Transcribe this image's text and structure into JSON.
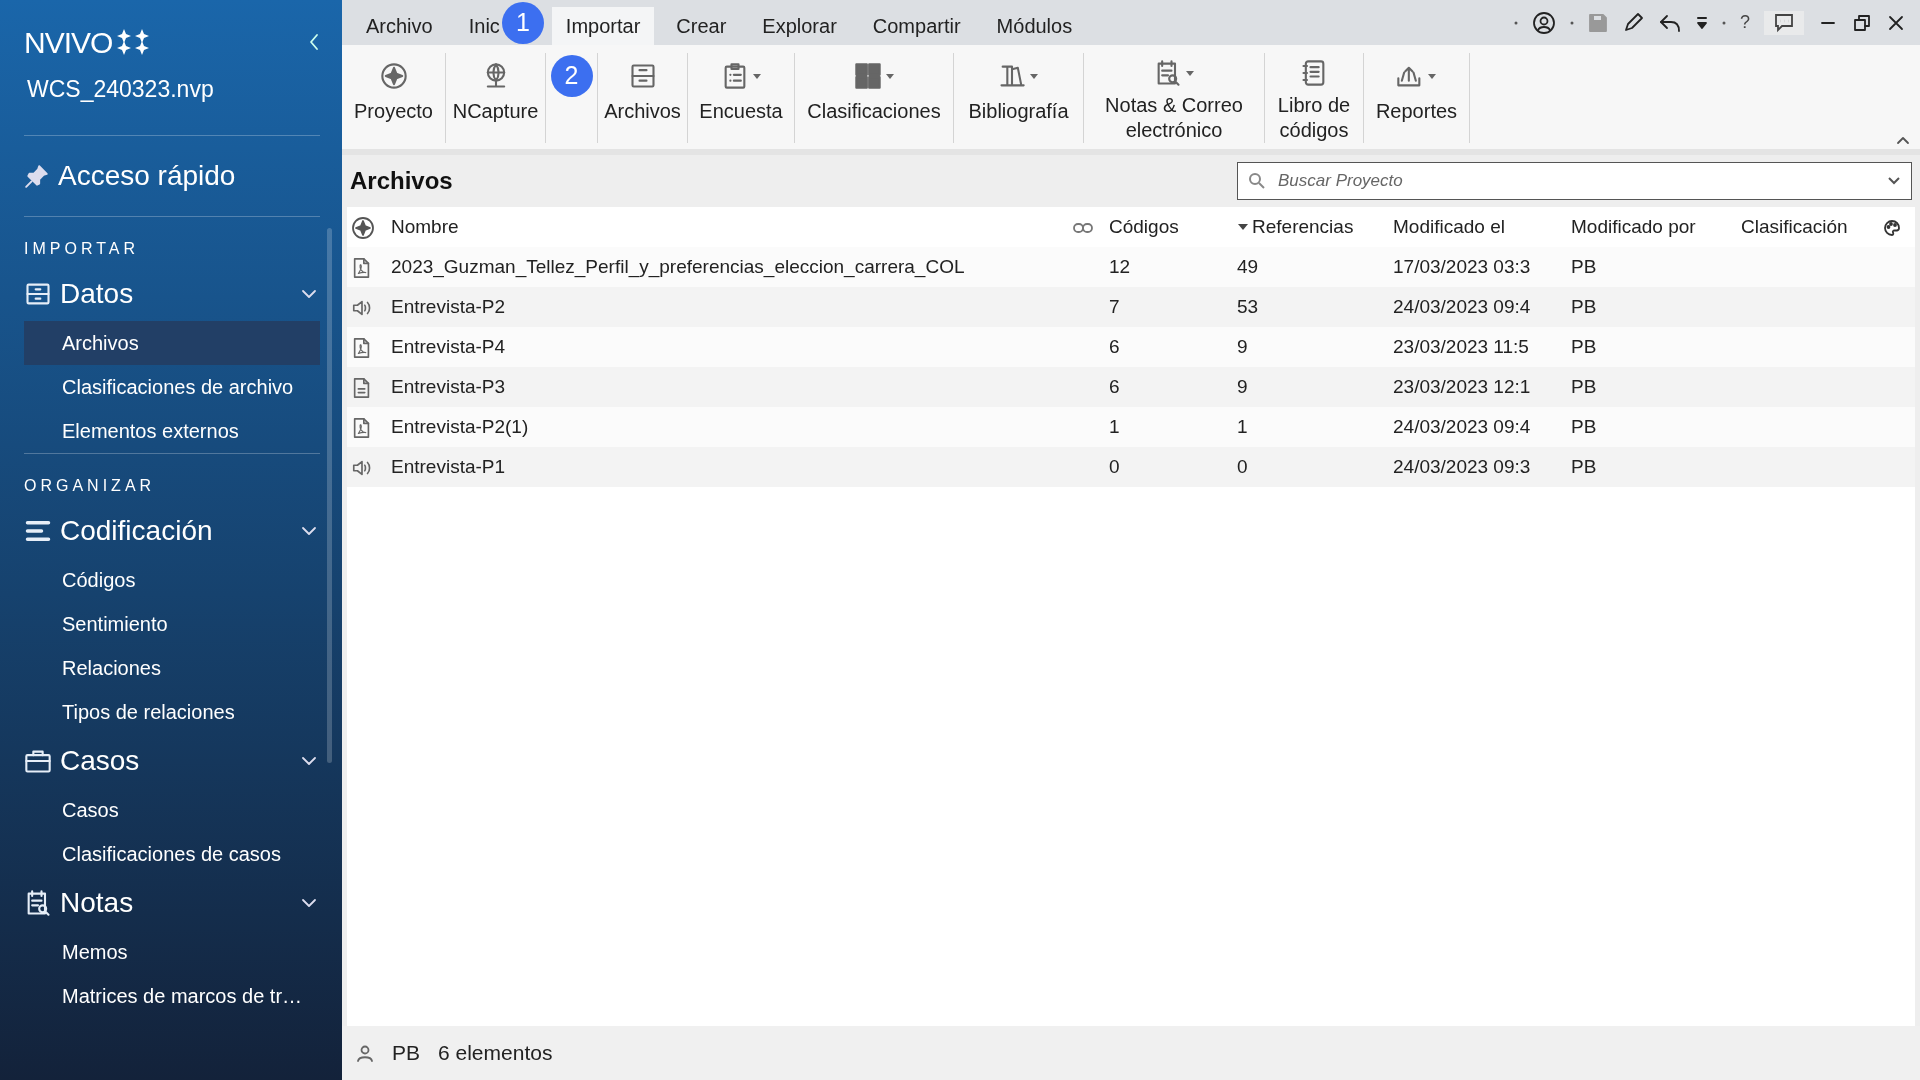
{
  "sidebar": {
    "logo": "NVIVO",
    "project": "WCS_240323.nvp",
    "quick_access": "Acceso rápido",
    "sections": [
      {
        "label": "IMPORTAR",
        "groups": [
          {
            "title": "Datos",
            "expanded": true,
            "items": [
              {
                "label": "Archivos",
                "selected": true
              },
              {
                "label": "Clasificaciones de archivo",
                "selected": false
              },
              {
                "label": "Elementos externos",
                "selected": false
              }
            ]
          }
        ]
      },
      {
        "label": "ORGANIZAR",
        "groups": [
          {
            "title": "Codificación",
            "expanded": true,
            "items": [
              {
                "label": "Códigos",
                "selected": false
              },
              {
                "label": "Sentimiento",
                "selected": false
              },
              {
                "label": "Relaciones",
                "selected": false
              },
              {
                "label": "Tipos de relaciones",
                "selected": false
              }
            ]
          },
          {
            "title": "Casos",
            "expanded": true,
            "items": [
              {
                "label": "Casos",
                "selected": false
              },
              {
                "label": "Clasificaciones de casos",
                "selected": false
              }
            ]
          },
          {
            "title": "Notas",
            "expanded": true,
            "items": [
              {
                "label": "Memos",
                "selected": false
              },
              {
                "label": "Matrices de marcos de tr…",
                "selected": false
              }
            ]
          }
        ]
      }
    ]
  },
  "menu": {
    "tabs": [
      {
        "label": "Archivo",
        "selected": false
      },
      {
        "label": "Inic",
        "selected": false,
        "callout": "1"
      },
      {
        "label": "Importar",
        "selected": true
      },
      {
        "label": "Crear",
        "selected": false
      },
      {
        "label": "Explorar",
        "selected": false
      },
      {
        "label": "Compartir",
        "selected": false
      },
      {
        "label": "Módulos",
        "selected": false
      }
    ],
    "help": "?"
  },
  "ribbon": {
    "buttons": [
      {
        "label": "Proyecto",
        "dropdown": false
      },
      {
        "label": "NCapture",
        "dropdown": false
      },
      {
        "label": "Archivos",
        "dropdown": false,
        "callout": "2"
      },
      {
        "label": "Encuesta",
        "dropdown": true
      },
      {
        "label": "Clasificaciones",
        "dropdown": true
      },
      {
        "label": "Bibliografía",
        "dropdown": true
      },
      {
        "label": "Notas & Correo electrónico",
        "dropdown": true
      },
      {
        "label": "Libro de códigos",
        "dropdown": false
      },
      {
        "label": "Reportes",
        "dropdown": true
      }
    ]
  },
  "panel": {
    "title": "Archivos",
    "search": {
      "placeholder": "Buscar Proyecto"
    },
    "columns": [
      {
        "label": "Nombre",
        "sorted": false
      },
      {
        "label": "Códigos",
        "sorted": false
      },
      {
        "label": "Referencias",
        "sorted": true
      },
      {
        "label": "Modificado el",
        "sorted": false
      },
      {
        "label": "Modificado por",
        "sorted": false
      },
      {
        "label": "Clasificación",
        "sorted": false
      }
    ],
    "rows": [
      {
        "kind": "pdf",
        "cells": [
          "2023_Guzman_Tellez_Perfil_y_preferencias_eleccion_carrera_COL",
          "12",
          "49",
          "17/03/2023 03:3",
          "PB"
        ]
      },
      {
        "kind": "audio",
        "cells": [
          "Entrevista-P2",
          "7",
          "53",
          "24/03/2023 09:4",
          "PB"
        ]
      },
      {
        "kind": "pdf",
        "cells": [
          "Entrevista-P4",
          "6",
          "9",
          "23/03/2023 11:5",
          "PB"
        ]
      },
      {
        "kind": "document",
        "cells": [
          "Entrevista-P3",
          "6",
          "9",
          "23/03/2023 12:1",
          "PB"
        ]
      },
      {
        "kind": "pdf",
        "cells": [
          "Entrevista-P2(1)",
          "1",
          "1",
          "24/03/2023 09:4",
          "PB"
        ]
      },
      {
        "kind": "audio",
        "cells": [
          "Entrevista-P1",
          "0",
          "0",
          "24/03/2023 09:3",
          "PB"
        ]
      }
    ]
  },
  "status_bar": {
    "user": "PB",
    "count": "6 elementos"
  }
}
